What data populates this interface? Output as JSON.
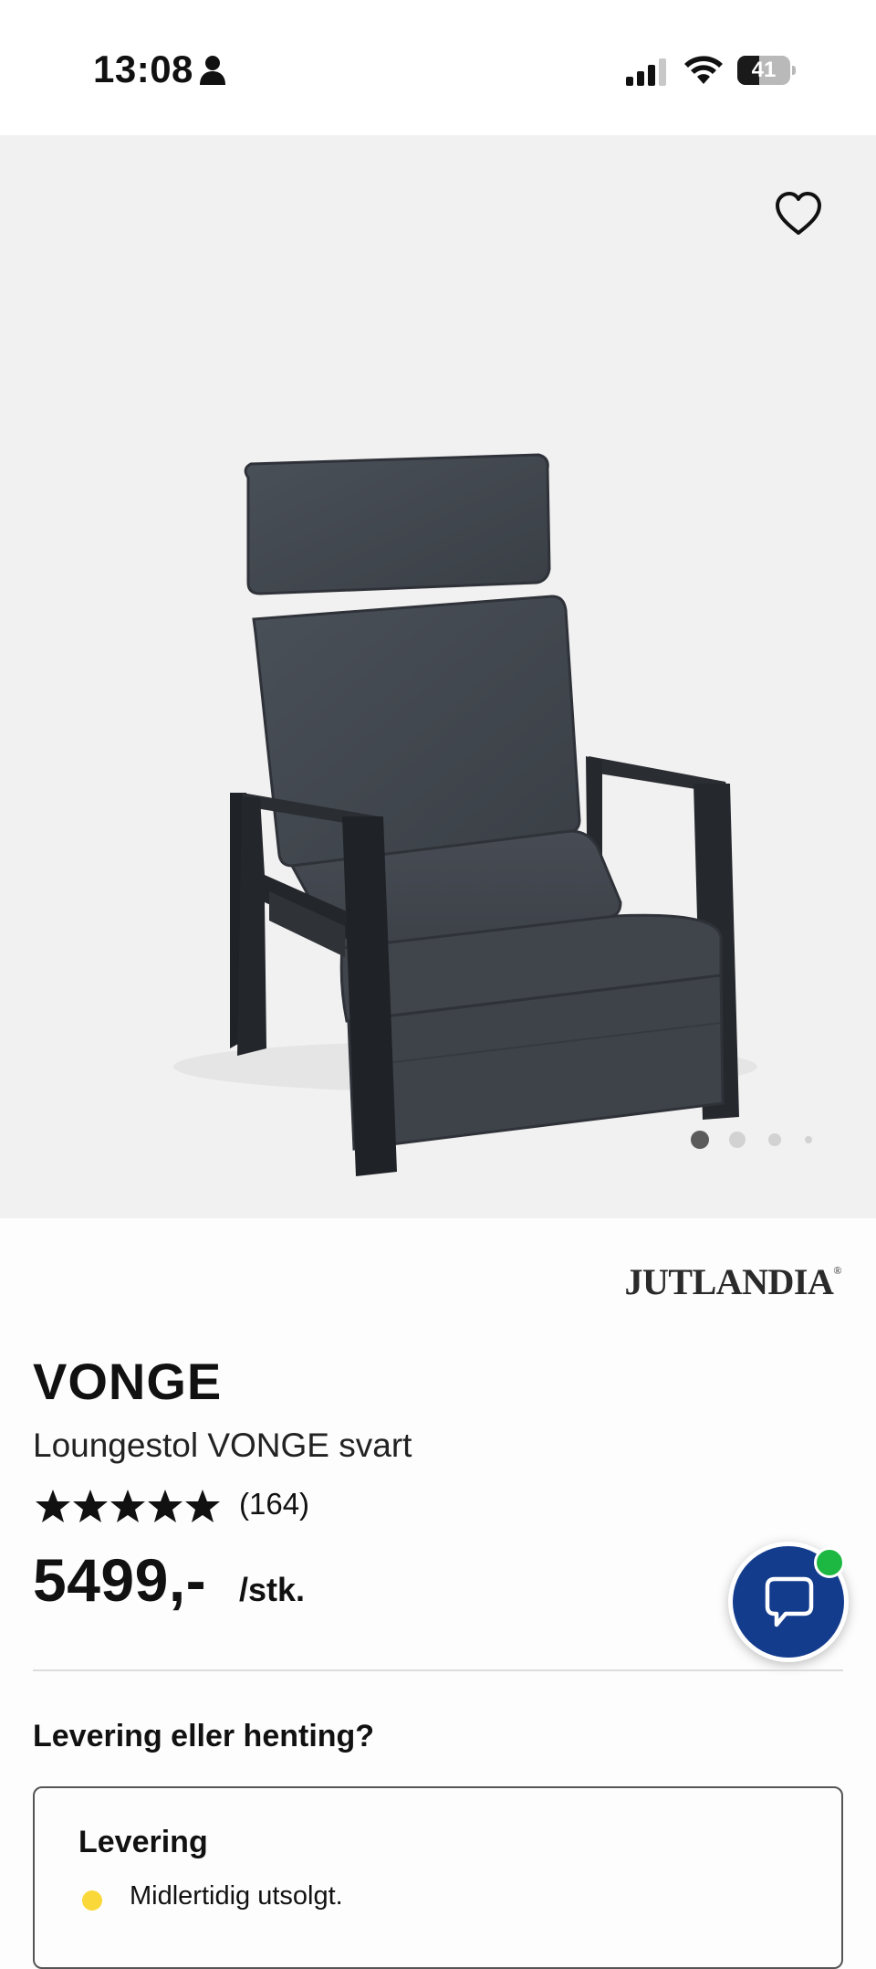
{
  "status_bar": {
    "time": "13:08",
    "battery_level": "41",
    "icons": [
      "person-icon",
      "signal-icon",
      "wifi-icon",
      "battery-icon"
    ]
  },
  "gallery": {
    "image": "chair-photo",
    "favorite_icon": "heart-outline-icon",
    "page_count": 4,
    "active_page": 1
  },
  "product": {
    "brand": "JUTLANDIA",
    "brand_mark": "®",
    "name": "VONGE",
    "description": "Loungestol VONGE svart",
    "rating_stars": 5,
    "review_count": "(164)",
    "price": "5499,-",
    "unit": "/stk."
  },
  "chat": {
    "icon": "chat-bubble-icon",
    "status": "online"
  },
  "delivery": {
    "heading": "Levering eller henting?",
    "card_title": "Levering",
    "stock_status": "Midlertidig utsolgt."
  },
  "colors": {
    "gallery_bg": "#f2f1f2",
    "chat_blue": "#133c8d",
    "online_green": "#1db842",
    "stock_yellow": "#fbd83a"
  }
}
